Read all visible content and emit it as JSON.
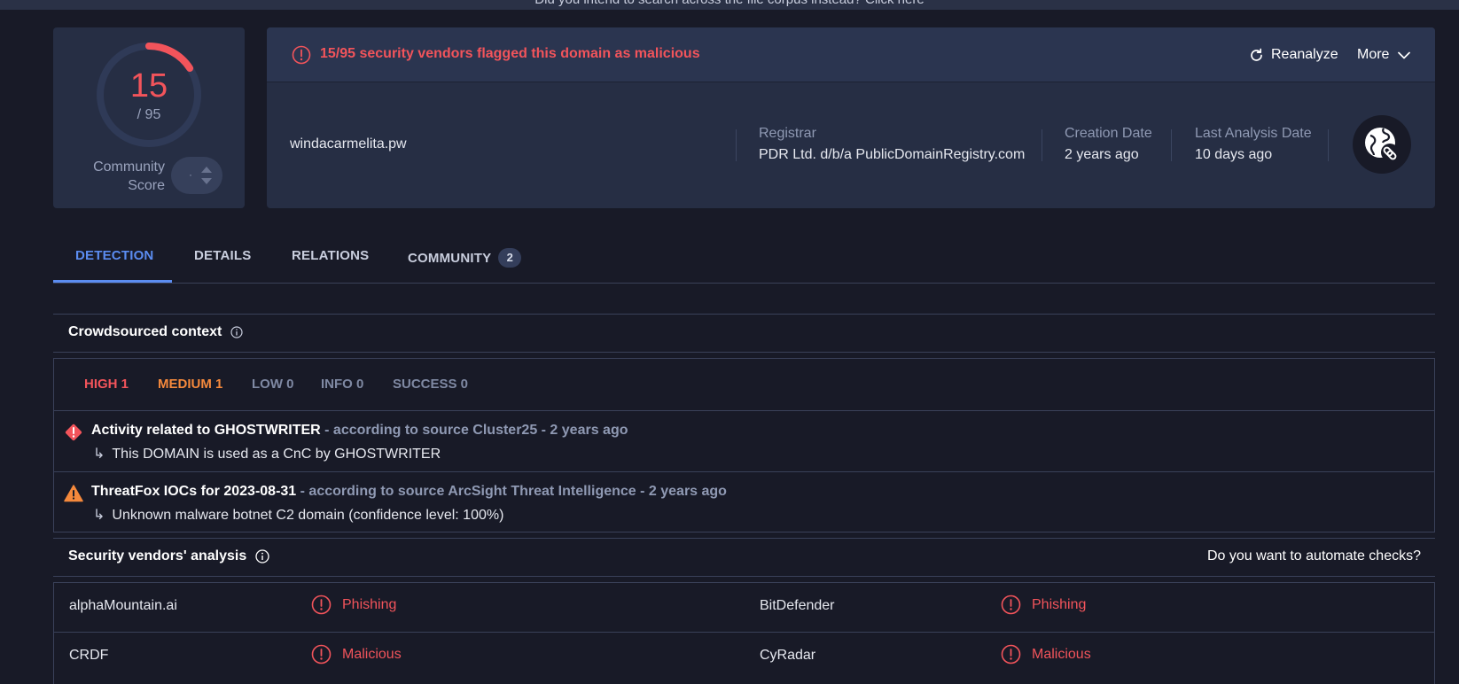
{
  "top_banner": "Did you intend to search across the file corpus instead? Click here",
  "score": {
    "detections": "15",
    "total": "/ 95",
    "detected_fraction": 0.158,
    "community_label": "Community Score",
    "vote_dot": "·"
  },
  "alert": {
    "text": "15/95 security vendors flagged this domain as malicious",
    "reanalyze_label": "Reanalyze",
    "more_label": "More"
  },
  "domain": {
    "name": "windacarmelita.pw",
    "registrar_label": "Registrar",
    "registrar_value": "PDR Ltd. d/b/a PublicDomainRegistry.com",
    "creation_label": "Creation Date",
    "creation_value": "2 years ago",
    "last_analysis_label": "Last Analysis Date",
    "last_analysis_value": "10 days ago"
  },
  "tabs": [
    {
      "label": "DETECTION"
    },
    {
      "label": "DETAILS"
    },
    {
      "label": "RELATIONS"
    },
    {
      "label": "COMMUNITY",
      "badge": "2"
    }
  ],
  "crowdsourced": {
    "title": "Crowdsourced context",
    "severity_tabs": [
      {
        "label": "HIGH 1",
        "color": "#f2545b"
      },
      {
        "label": "MEDIUM 1",
        "color": "#f5893c"
      },
      {
        "label": "LOW 0",
        "color": "#7f89a3"
      },
      {
        "label": "INFO 0",
        "color": "#7f89a3"
      },
      {
        "label": "SUCCESS 0",
        "color": "#7f89a3"
      }
    ],
    "items": [
      {
        "title": "Activity related to GHOSTWRITER",
        "source": " - according to source Cluster25 - 2 years ago",
        "detail": "This DOMAIN is used as a CnC by GHOSTWRITER",
        "severity_color": "#f2545b"
      },
      {
        "title": "ThreatFox IOCs for 2023-08-31",
        "source": " - according to source ArcSight Threat Intelligence - 2 years ago",
        "detail": "Unknown malware botnet C2 domain (confidence level: 100%)",
        "severity_color": "#f5893c"
      }
    ],
    "arrow": "↳"
  },
  "vendors": {
    "title": "Security vendors' analysis",
    "automate_label": "Do you want to automate checks?",
    "rows": [
      [
        {
          "vendor": "alphaMountain.ai",
          "verdict": "Phishing"
        },
        {
          "vendor": "BitDefender",
          "verdict": "Phishing"
        }
      ],
      [
        {
          "vendor": "CRDF",
          "verdict": "Malicious"
        },
        {
          "vendor": "CyRadar",
          "verdict": "Malicious"
        }
      ]
    ]
  },
  "colors": {
    "malicious": "#f2545b",
    "accent": "#5b8cf0",
    "background": "#181a27",
    "card": "#262e44"
  }
}
